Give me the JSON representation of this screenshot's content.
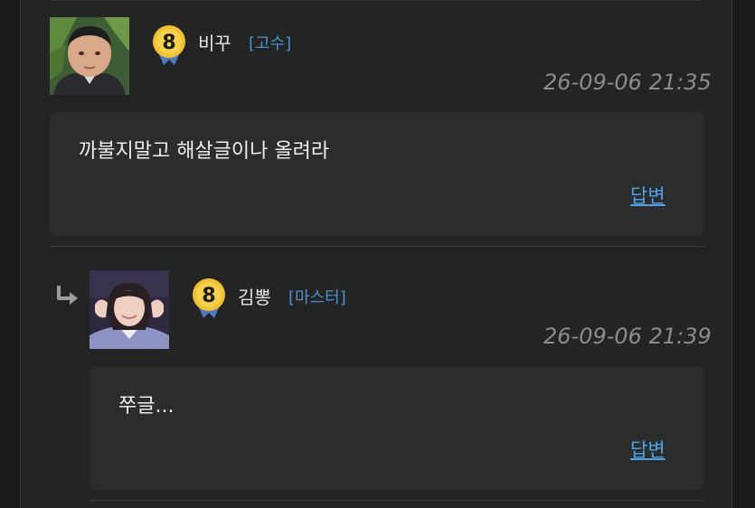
{
  "comments": [
    {
      "nickname": "비꾸",
      "rank": "[고수]",
      "level": "8",
      "timestamp": "26-09-06 21:35",
      "text": "까불지말고 해살글이나 올려라",
      "reply_label": "답변"
    },
    {
      "nickname": "김뽕",
      "rank": "[마스터]",
      "level": "8",
      "timestamp": "26-09-06 21:39",
      "text": "쭈글...",
      "reply_label": "답변",
      "is_reply": true
    }
  ],
  "icons": {
    "level_badge": "level-badge-icon",
    "reply_arrow": "reply-arrow-icon"
  },
  "colors": {
    "background": "#232525",
    "bubble": "#2b2d2d",
    "rank": "#4a8fd0",
    "link": "#4ea3e6",
    "timestamp": "#8b8b8b",
    "badge_gold": "#f2c12e"
  }
}
